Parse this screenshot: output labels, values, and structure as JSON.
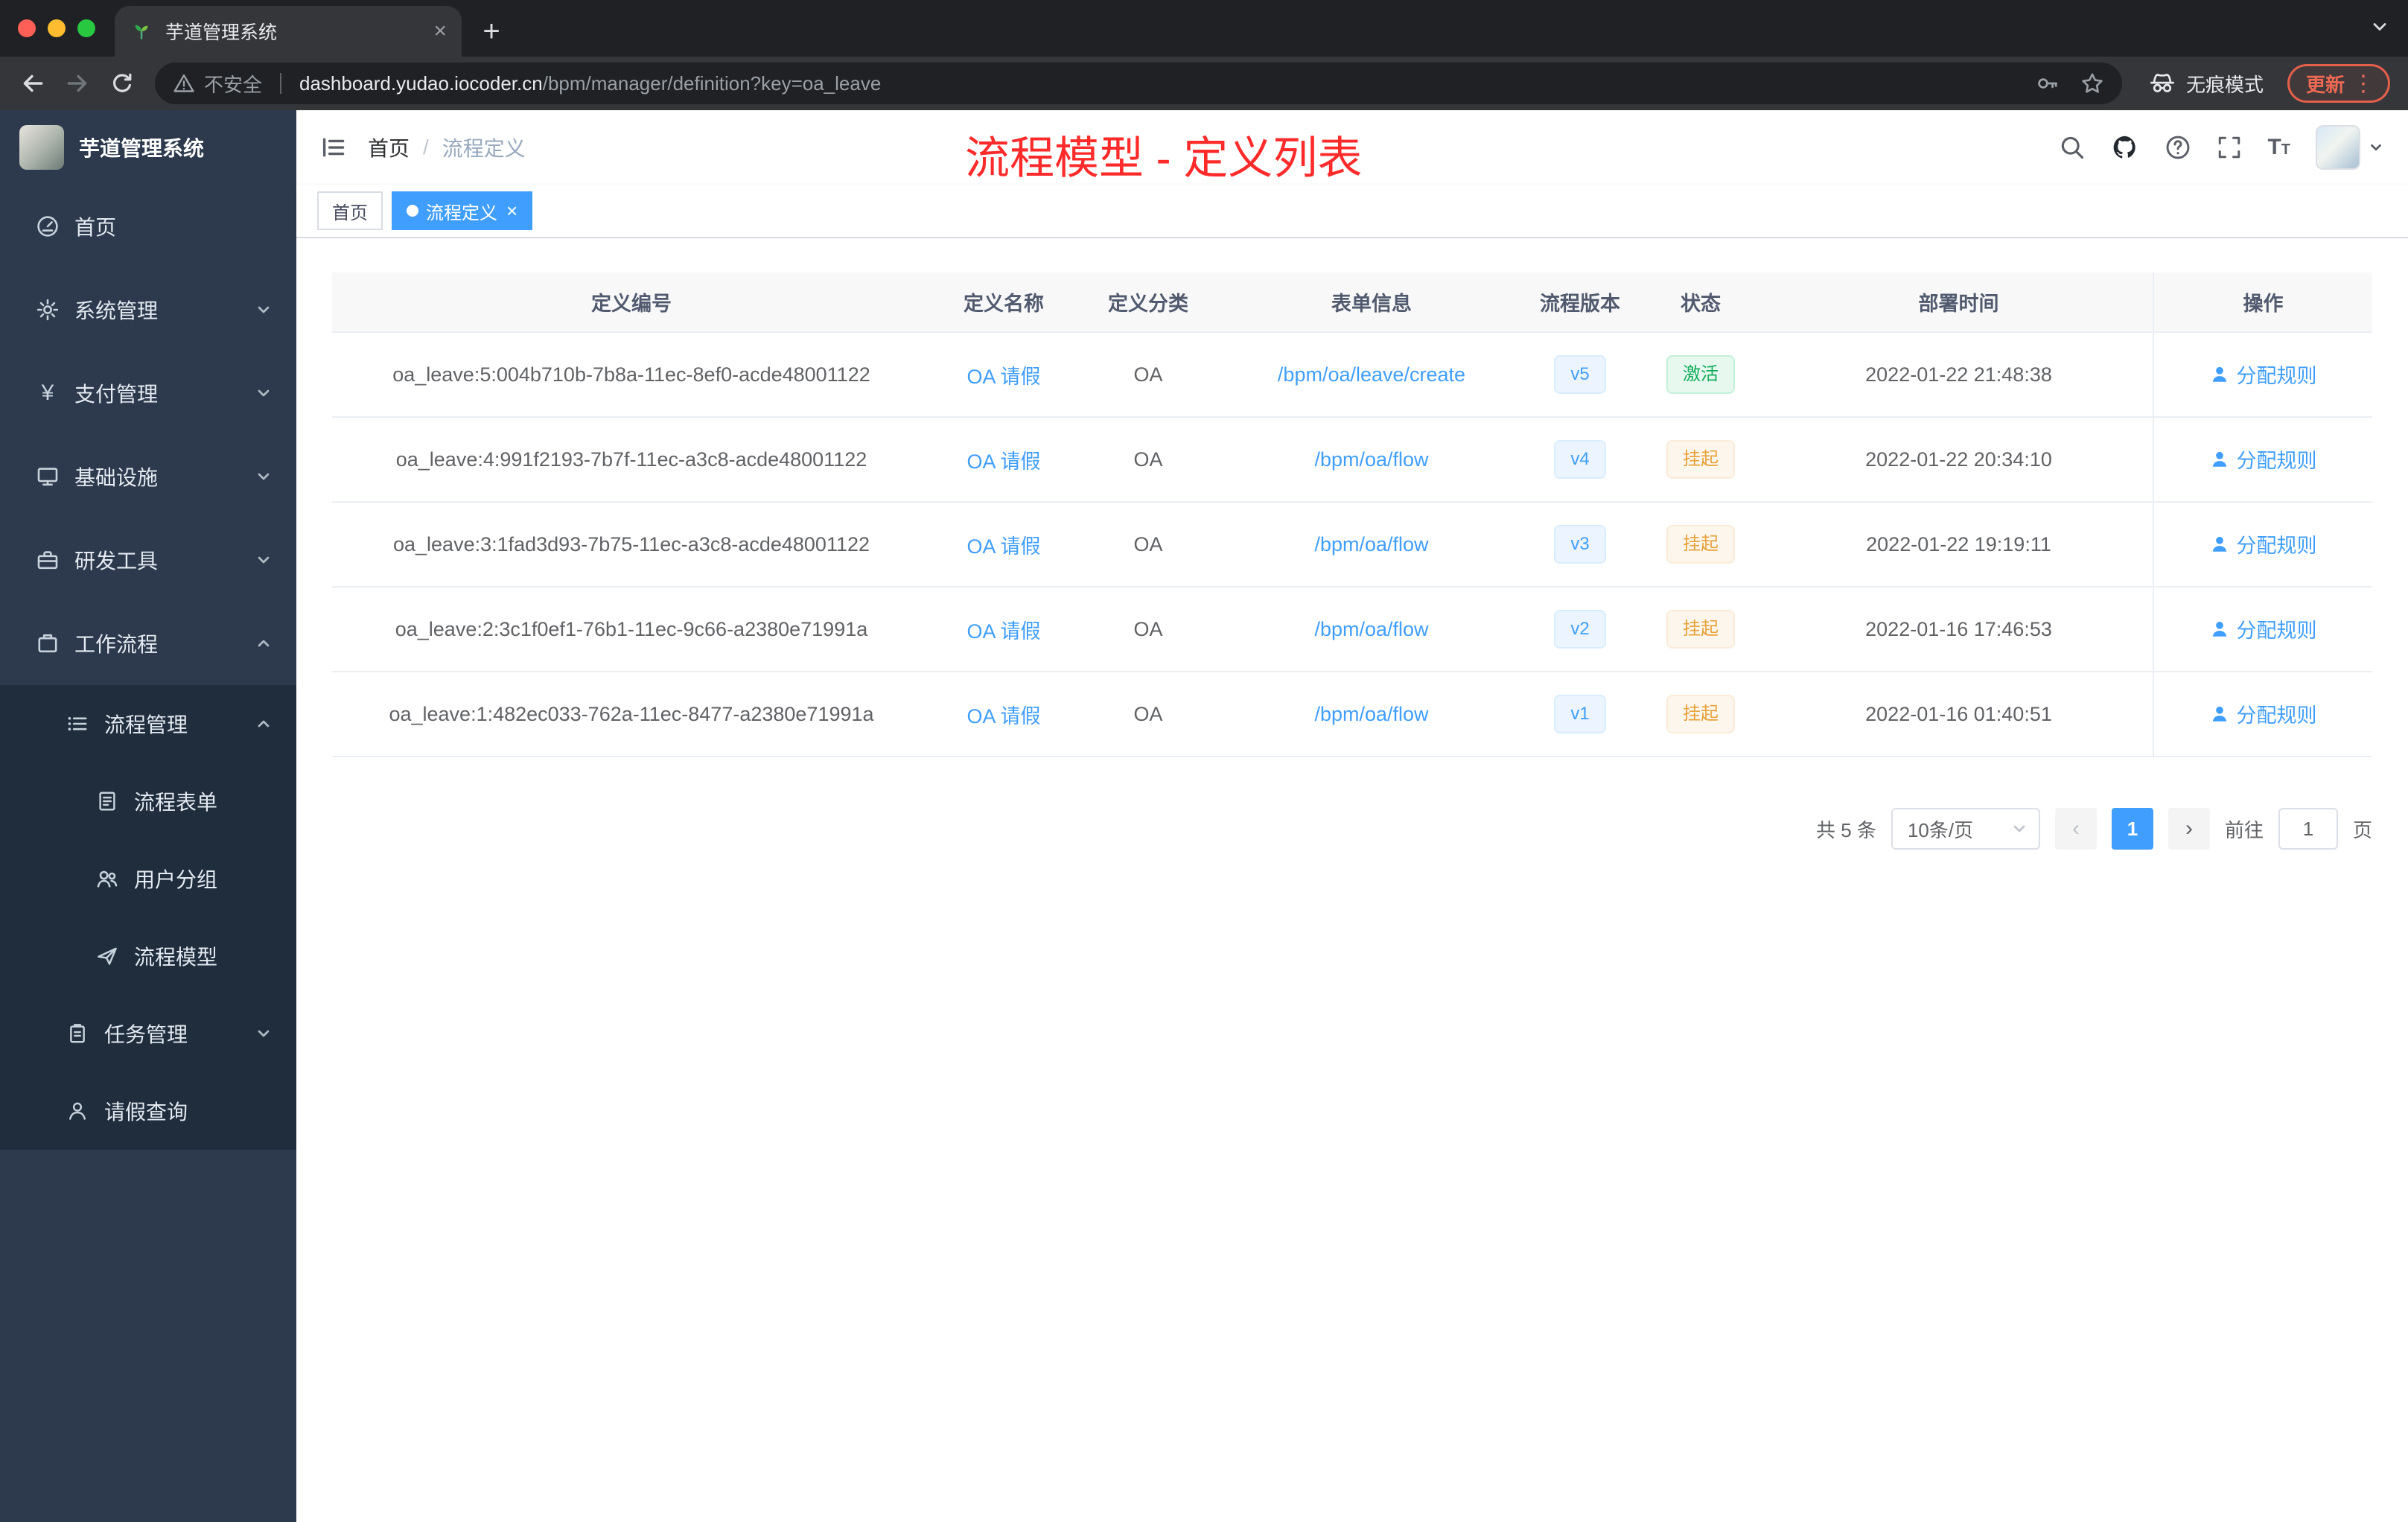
{
  "browser": {
    "tab_title": "芋道管理系统",
    "security_label": "不安全",
    "url_domain": "dashboard.yudao.iocoder.cn",
    "url_path": "/bpm/manager/definition?key=oa_leave",
    "incognito_label": "无痕模式",
    "update_label": "更新"
  },
  "sidebar": {
    "logo_title": "芋道管理系统",
    "items": [
      {
        "label": "首页"
      },
      {
        "label": "系统管理"
      },
      {
        "label": "支付管理"
      },
      {
        "label": "基础设施"
      },
      {
        "label": "研发工具"
      },
      {
        "label": "工作流程"
      },
      {
        "label": "流程管理"
      },
      {
        "label": "流程表单"
      },
      {
        "label": "用户分组"
      },
      {
        "label": "流程模型"
      },
      {
        "label": "任务管理"
      },
      {
        "label": "请假查询"
      }
    ]
  },
  "navbar": {
    "breadcrumb_home": "首页",
    "breadcrumb_separator": "/",
    "breadcrumb_current": "流程定义"
  },
  "annotation": "流程模型 - 定义列表",
  "tags": {
    "home": "首页",
    "active": "流程定义"
  },
  "table": {
    "headers": [
      "定义编号",
      "定义名称",
      "定义分类",
      "表单信息",
      "流程版本",
      "状态",
      "部署时间",
      "操作"
    ],
    "rows": [
      {
        "id": "oa_leave:5:004b710b-7b8a-11ec-8ef0-acde48001122",
        "name": "OA 请假",
        "category": "OA",
        "form": "/bpm/oa/leave/create",
        "version": "v5",
        "status": "激活",
        "time": "2022-01-22 21:48:38",
        "action": "分配规则"
      },
      {
        "id": "oa_leave:4:991f2193-7b7f-11ec-a3c8-acde48001122",
        "name": "OA 请假",
        "category": "OA",
        "form": "/bpm/oa/flow",
        "version": "v4",
        "status": "挂起",
        "time": "2022-01-22 20:34:10",
        "action": "分配规则"
      },
      {
        "id": "oa_leave:3:1fad3d93-7b75-11ec-a3c8-acde48001122",
        "name": "OA 请假",
        "category": "OA",
        "form": "/bpm/oa/flow",
        "version": "v3",
        "status": "挂起",
        "time": "2022-01-22 19:19:11",
        "action": "分配规则"
      },
      {
        "id": "oa_leave:2:3c1f0ef1-76b1-11ec-9c66-a2380e71991a",
        "name": "OA 请假",
        "category": "OA",
        "form": "/bpm/oa/flow",
        "version": "v2",
        "status": "挂起",
        "time": "2022-01-16 17:46:53",
        "action": "分配规则"
      },
      {
        "id": "oa_leave:1:482ec033-762a-11ec-8477-a2380e71991a",
        "name": "OA 请假",
        "category": "OA",
        "form": "/bpm/oa/flow",
        "version": "v1",
        "status": "挂起",
        "time": "2022-01-16 01:40:51",
        "action": "分配规则"
      }
    ]
  },
  "pagination": {
    "total": "共 5 条",
    "page_size": "10条/页",
    "current_page": "1",
    "goto_label": "前往",
    "goto_value": "1",
    "page_unit": "页"
  },
  "colors": {
    "accent": "#409eff",
    "sidebar_bg": "#2d3a4d",
    "submenu_bg": "#1f2d3d",
    "success": "#13ab5b",
    "warning": "#e6a23c",
    "annotation_red": "#ff2b2b"
  }
}
